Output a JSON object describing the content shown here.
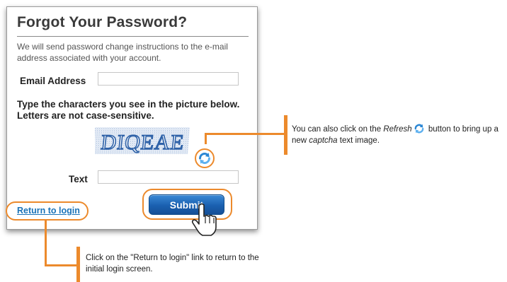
{
  "dialog": {
    "title": "Forgot Your Password?",
    "intro": "We will send password change instructions to the e-mail address associated with your account.",
    "email_label": "Email Address",
    "email_value": "",
    "instructions": "Type the characters you see in the picture below. Letters are not case-sensitive.",
    "captcha_text": "DIQEAE",
    "text_label": "Text",
    "text_value": "",
    "return_link": "Return to login",
    "submit_label": "Submit"
  },
  "callouts": {
    "refresh": {
      "before": "You can also click on the ",
      "italic": "Refresh",
      "after_icon": " button to bring up a new ",
      "italic2": "captcha",
      "end": " text image."
    },
    "login": "Click on the \"Return to login\" link to return to the initial login screen."
  },
  "colors": {
    "accent_orange": "#ec8a2c",
    "link_blue": "#1a73b8",
    "button_blue": "#1a60b0"
  },
  "icons": [
    "refresh-icon",
    "hand-cursor-icon"
  ]
}
